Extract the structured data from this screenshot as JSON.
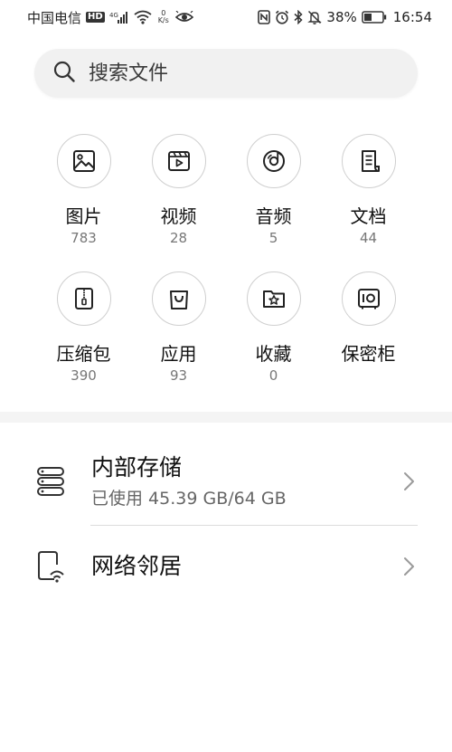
{
  "status_bar": {
    "carrier": "中国电信",
    "hd_badge": "HD",
    "network_type": "4G",
    "net_speed_value": "0",
    "net_speed_unit": "K/s",
    "battery_percent": "38%",
    "time": "16:54"
  },
  "search": {
    "placeholder": "搜索文件"
  },
  "categories": [
    {
      "label": "图片",
      "count": "783",
      "icon": "image-icon"
    },
    {
      "label": "视频",
      "count": "28",
      "icon": "video-icon"
    },
    {
      "label": "音频",
      "count": "5",
      "icon": "audio-icon"
    },
    {
      "label": "文档",
      "count": "44",
      "icon": "document-icon"
    },
    {
      "label": "压缩包",
      "count": "390",
      "icon": "archive-icon"
    },
    {
      "label": "应用",
      "count": "93",
      "icon": "app-bag-icon"
    },
    {
      "label": "收藏",
      "count": "0",
      "icon": "favorites-folder-icon"
    },
    {
      "label": "保密柜",
      "count": "",
      "icon": "safe-icon"
    }
  ],
  "storage": {
    "internal": {
      "title": "内部存储",
      "usage": "已使用 45.39 GB/64 GB",
      "icon": "storage-icon"
    },
    "network": {
      "title": "网络邻居",
      "icon": "network-neighborhood-icon"
    }
  },
  "colors": {
    "background": "#ffffff",
    "search_bg": "#f1f1f1",
    "icon_stroke": "#222222",
    "circle_border": "#cfcfcf",
    "secondary_text": "#777777",
    "band": "#f4f4f4"
  }
}
